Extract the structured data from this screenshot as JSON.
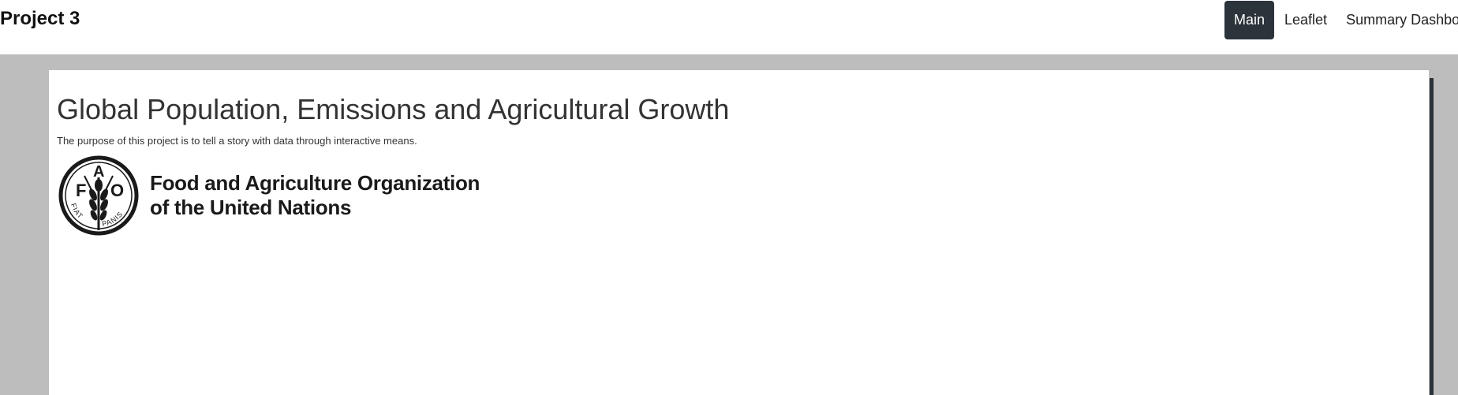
{
  "header": {
    "brand": "Project 3",
    "nav": [
      {
        "label": "Main",
        "active": true
      },
      {
        "label": "Leaflet",
        "active": false
      },
      {
        "label": "Summary Dashbo",
        "active": false
      }
    ]
  },
  "main": {
    "title": "Global Population, Emissions and Agricultural Growth",
    "description": "The purpose of this project is to tell a story with data through interactive means.",
    "logo": {
      "emblem_letters": [
        "F",
        "A",
        "O"
      ],
      "motto_left": "FIAT",
      "motto_right": "PANIS",
      "line1": "Food and Agriculture Organization",
      "line2": "of the United Nations"
    }
  },
  "colors": {
    "nav_active_bg": "#2b333b",
    "page_bg": "#bdbdbd",
    "panel_bg": "#ffffff"
  }
}
